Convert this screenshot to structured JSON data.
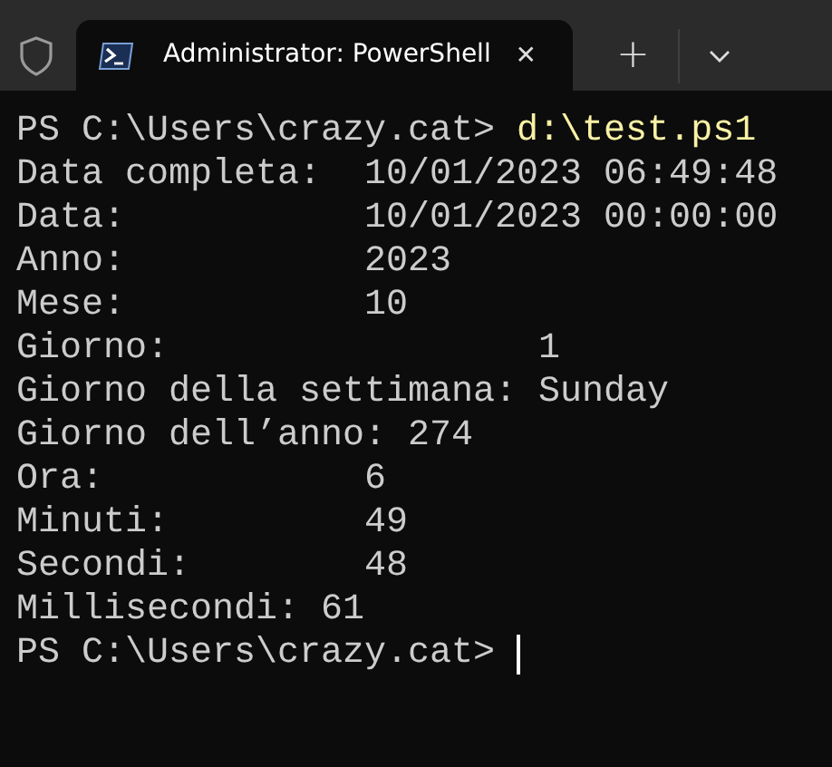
{
  "tab": {
    "title": "Administrator: PowerShell",
    "selected": true,
    "close": "✕"
  },
  "new_tab": "+",
  "terminal": {
    "lines": [
      {
        "kind": "prompt",
        "prompt": "PS C:\\Users\\crazy.cat>",
        "command": "d:\\test.ps1",
        "cursor": false
      },
      {
        "kind": "output",
        "text": "Data completa:  10/01/2023 06:49:48"
      },
      {
        "kind": "output",
        "text": "Data:           10/01/2023 00:00:00"
      },
      {
        "kind": "output",
        "text": "Anno:           2023"
      },
      {
        "kind": "output",
        "text": "Mese:           10"
      },
      {
        "kind": "output",
        "text": "Giorno:                 1"
      },
      {
        "kind": "output",
        "text": "Giorno della settimana: Sunday"
      },
      {
        "kind": "output",
        "text": "Giorno dell’anno: 274"
      },
      {
        "kind": "output",
        "text": "Ora:            6"
      },
      {
        "kind": "output",
        "text": "Minuti:         49"
      },
      {
        "kind": "output",
        "text": "Secondi:        48"
      },
      {
        "kind": "output",
        "text": "Millisecondi: 61"
      },
      {
        "kind": "prompt",
        "prompt": "PS C:\\Users\\crazy.cat>",
        "cursor": true
      }
    ]
  }
}
